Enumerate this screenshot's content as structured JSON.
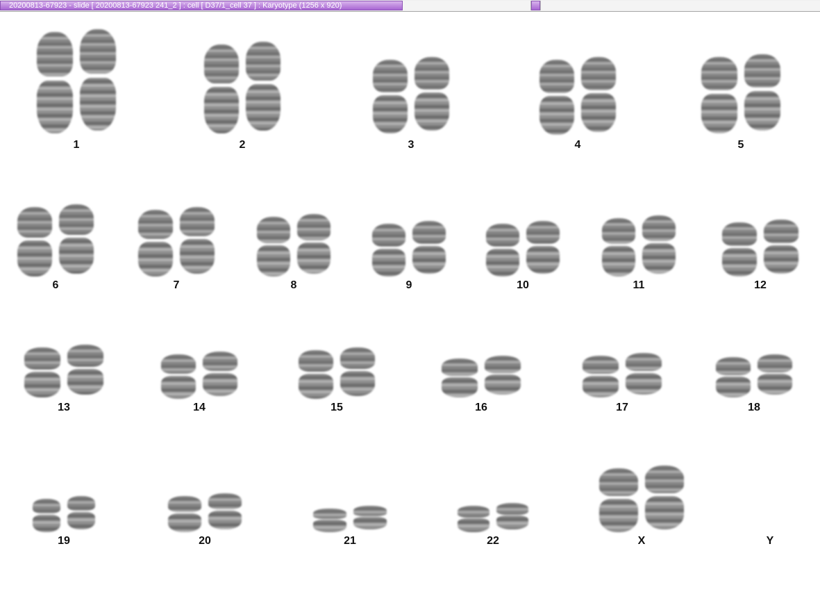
{
  "window": {
    "title": "20200813-67923 - slide [ 20200813-67923 241_2 ] : cell [ D37/1_cell 37 ] : Karyotype  (1256 x 920)"
  },
  "karyotype": {
    "chromosomes": [
      {
        "label": "1"
      },
      {
        "label": "2"
      },
      {
        "label": "3"
      },
      {
        "label": "4"
      },
      {
        "label": "5"
      },
      {
        "label": "6"
      },
      {
        "label": "7"
      },
      {
        "label": "8"
      },
      {
        "label": "9"
      },
      {
        "label": "10"
      },
      {
        "label": "11"
      },
      {
        "label": "12"
      },
      {
        "label": "13"
      },
      {
        "label": "14"
      },
      {
        "label": "15"
      },
      {
        "label": "16"
      },
      {
        "label": "17"
      },
      {
        "label": "18"
      },
      {
        "label": "19"
      },
      {
        "label": "20"
      },
      {
        "label": "21"
      },
      {
        "label": "22"
      },
      {
        "label": "X"
      },
      {
        "label": "Y"
      }
    ]
  }
}
